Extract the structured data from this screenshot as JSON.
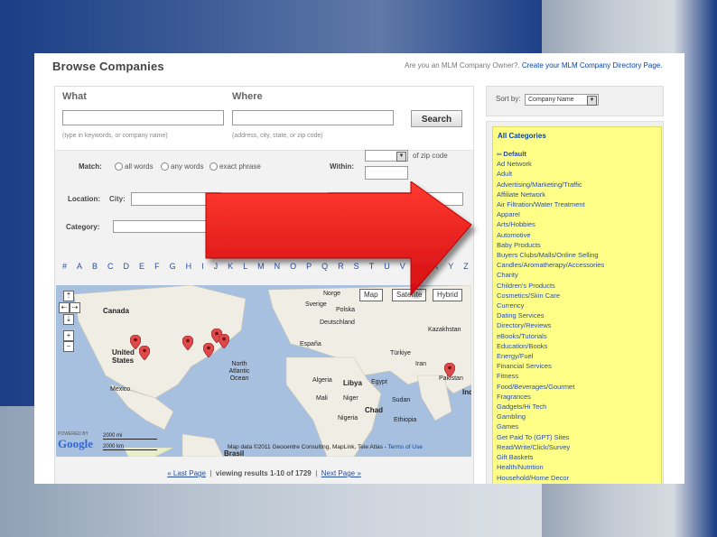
{
  "page": {
    "title": "Browse Companies",
    "owner_prefix": "Are you an MLM Company Owner?.",
    "owner_link": "Create your MLM Company Directory Page."
  },
  "search": {
    "what_label": "What",
    "where_label": "Where",
    "what_hint": "(type in keywords, or company name)",
    "where_hint": "(address, city, state, or zip code)",
    "search_button": "Search",
    "match_label": "Match:",
    "match_options": [
      "all words",
      "any words",
      "exact phrase"
    ],
    "within_label": "Within:",
    "within_suffix": "of zip code",
    "location_label": "Location:",
    "city_label": "City:",
    "category_label": "Category:"
  },
  "alphabet": [
    "#",
    "A",
    "B",
    "C",
    "D",
    "E",
    "F",
    "G",
    "H",
    "I",
    "J",
    "K",
    "L",
    "M",
    "N",
    "O",
    "P",
    "Q",
    "R",
    "S",
    "T",
    "U",
    "V",
    "W",
    "X",
    "Y",
    "Z"
  ],
  "map": {
    "tabs": [
      "Map",
      "Satellite",
      "Hybrid"
    ],
    "labels": {
      "canada": "Canada",
      "united_states": "United States",
      "mexico": "Mexico",
      "north_atlantic": "North Atlantic Ocean",
      "norge": "Norge",
      "sverige": "Sverige",
      "polska": "Polska",
      "deutschland": "Deutschland",
      "espana": "España",
      "kazakhstan": "Kazakhstan",
      "algeria": "Algeria",
      "libya": "Libya",
      "egypt": "Egypt",
      "mali": "Mali",
      "niger": "Niger",
      "chad": "Chad",
      "sudan": "Sudan",
      "ethiopia": "Ethiopia",
      "nigeria": "Nigeria",
      "turkey": "Türkiye",
      "iran": "Iran",
      "pakistan": "Pakistan",
      "india": "Indi",
      "brasil": "Brasil"
    },
    "scale_mi": "2000 mi",
    "scale_km": "2000 km",
    "powered_by": "POWERED BY",
    "google": "Google",
    "attribution": "Map data ©2011 Geocentre Consulting, MapLink, Tele Atlas -",
    "terms": "Terms of Use"
  },
  "pager": {
    "prev": "« Last Page",
    "viewing": "viewing results 1-10 of 1729",
    "next": "Next Page »"
  },
  "sort": {
    "label": "Sort by:",
    "value": "Company Name"
  },
  "categories": {
    "heading": "All Categories",
    "items": [
      "Default",
      "Ad Network",
      "Adult",
      "Advertising/Marketing/Traffic",
      "Affiliate Network",
      "Air Filtration/Water Treatment",
      "Apparel",
      "Arts/Hobbies",
      "Automotive",
      "Baby Products",
      "Buyers Clubs/Malls/Online Selling",
      "Candles/Aromatherapy/Accessories",
      "Charity",
      "Children's Products",
      "Cosmetics/Skin Care",
      "Currency",
      "Dating Services",
      "Directory/Reviews",
      "eBooks/Tutorials",
      "Education/Books",
      "Energy/Fuel",
      "Financial Services",
      "Fitness",
      "Food/Beverages/Gourmet",
      "Fragrances",
      "Gadgets/Hi Tech",
      "Gambling",
      "Games",
      "Get Paid To (GPT) Sites",
      "Read/Write/Click/Survey",
      "Gift Baskets",
      "Health/Nutrition",
      "Household/Home Decor"
    ]
  },
  "colors": {
    "highlight": "#ffff88",
    "arrow": "#e8161c",
    "link": "#2a4ea0"
  }
}
